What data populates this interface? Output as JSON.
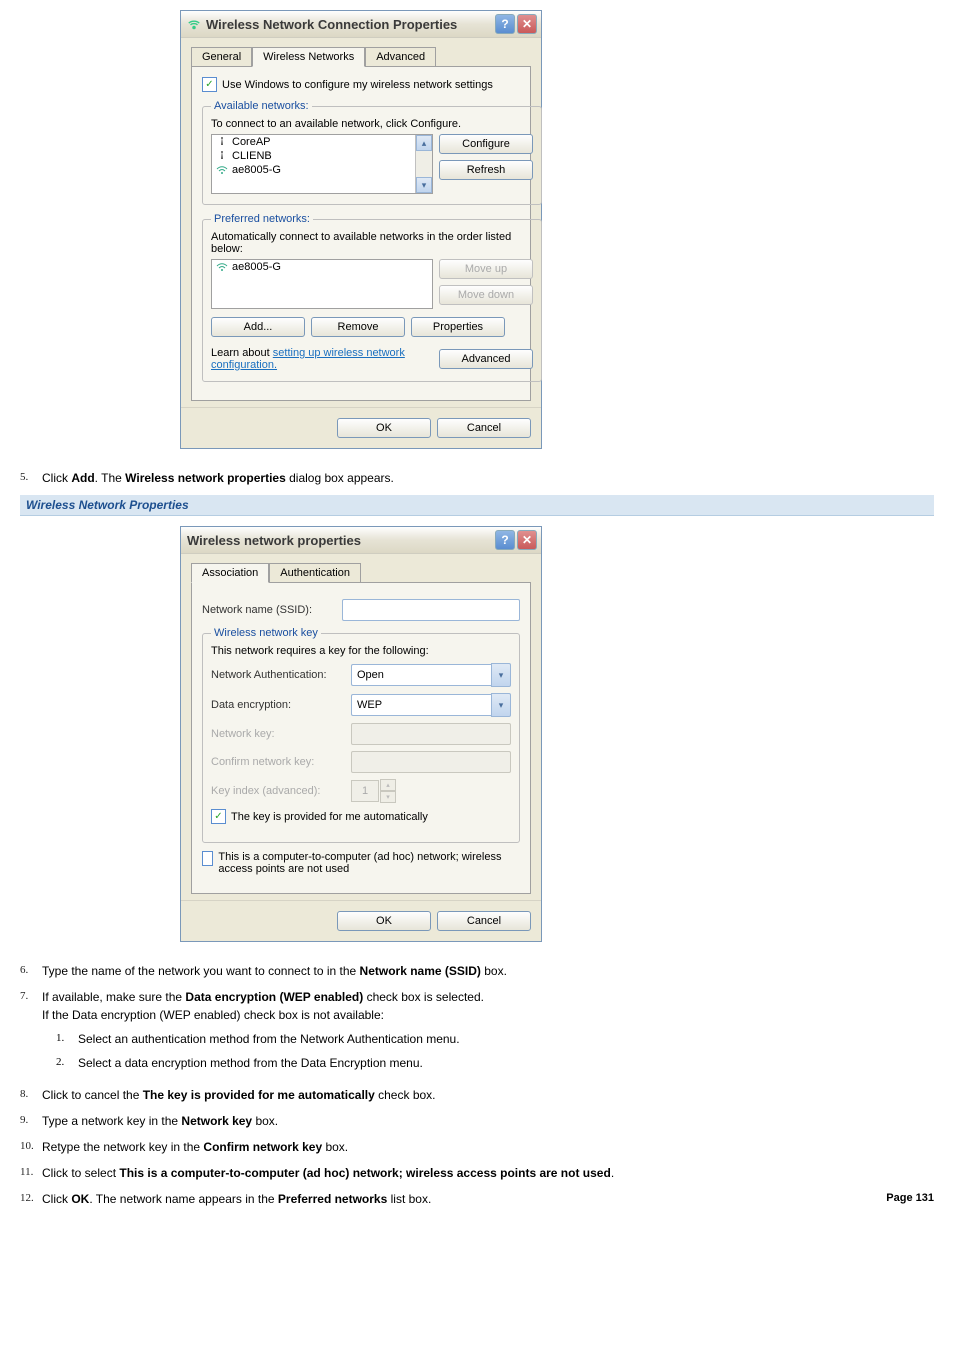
{
  "dlg1": {
    "title": "Wireless Network Connection Properties",
    "tabs": [
      "General",
      "Wireless Networks",
      "Advanced"
    ],
    "use_windows": "Use Windows to configure my wireless network settings",
    "available": {
      "legend": "Available networks:",
      "hint": "To connect to an available network, click Configure.",
      "items": [
        "CoreAP",
        "CLIENB",
        "ae8005-G"
      ],
      "configure": "Configure",
      "refresh": "Refresh"
    },
    "preferred": {
      "legend": "Preferred networks:",
      "hint": "Automatically connect to available networks in the order listed below:",
      "items": [
        "ae8005-G"
      ],
      "moveup": "Move up",
      "movedown": "Move down",
      "add": "Add...",
      "remove": "Remove",
      "properties": "Properties"
    },
    "learn": {
      "prefix": "Learn about ",
      "link": "setting up wireless network configuration."
    },
    "advanced": "Advanced",
    "ok": "OK",
    "cancel": "Cancel"
  },
  "step5": {
    "p1": "Click ",
    "b1": "Add",
    "p2": ". The ",
    "b2": "Wireless network properties",
    "p3": " dialog box appears."
  },
  "heading2": "Wireless Network Properties",
  "dlg2": {
    "title": "Wireless network properties",
    "tabs": [
      "Association",
      "Authentication"
    ],
    "ssid_label": "Network name (SSID):",
    "key_legend": "Wireless network key",
    "key_hint": "This network requires a key for the following:",
    "auth_label": "Network Authentication:",
    "auth_value": "Open",
    "enc_label": "Data encryption:",
    "enc_value": "WEP",
    "netkey_label": "Network key:",
    "confirm_label": "Confirm network key:",
    "index_label": "Key index (advanced):",
    "index_value": "1",
    "auto_key": "The key is provided for me automatically",
    "adhoc": "This is a computer-to-computer (ad hoc) network; wireless access points are not used",
    "ok": "OK",
    "cancel": "Cancel"
  },
  "step6": {
    "p1": "Type the name of the network you want to connect to in the ",
    "b1": "Network name (SSID)",
    "p2": " box."
  },
  "step7": {
    "p1": "If available, make sure the ",
    "b1": "Data encryption (WEP enabled)",
    "p2": " check box is selected.",
    "line2": "If the Data encryption (WEP enabled) check box is not available:",
    "sub1": "Select an authentication method from the Network Authentication menu.",
    "sub2": "Select a data encryption method from the Data Encryption menu."
  },
  "step8": {
    "p1": "Click to cancel the ",
    "b1": "The key is provided for me automatically",
    "p2": " check box."
  },
  "step9": {
    "p1": "Type a network key in the ",
    "b1": "Network key",
    "p2": " box."
  },
  "step10": {
    "p1": "Retype the network key in the ",
    "b1": "Confirm network key",
    "p2": " box."
  },
  "step11": {
    "p1": "Click to select ",
    "b1": "This is a computer-to-computer (ad hoc) network; wireless access points are not used",
    "p2": "."
  },
  "step12": {
    "p1": "Click ",
    "b1": "OK",
    "p2": ". The network name appears in the ",
    "b2": "Preferred networks",
    "p3": " list box."
  },
  "pagenum": "Page 131"
}
